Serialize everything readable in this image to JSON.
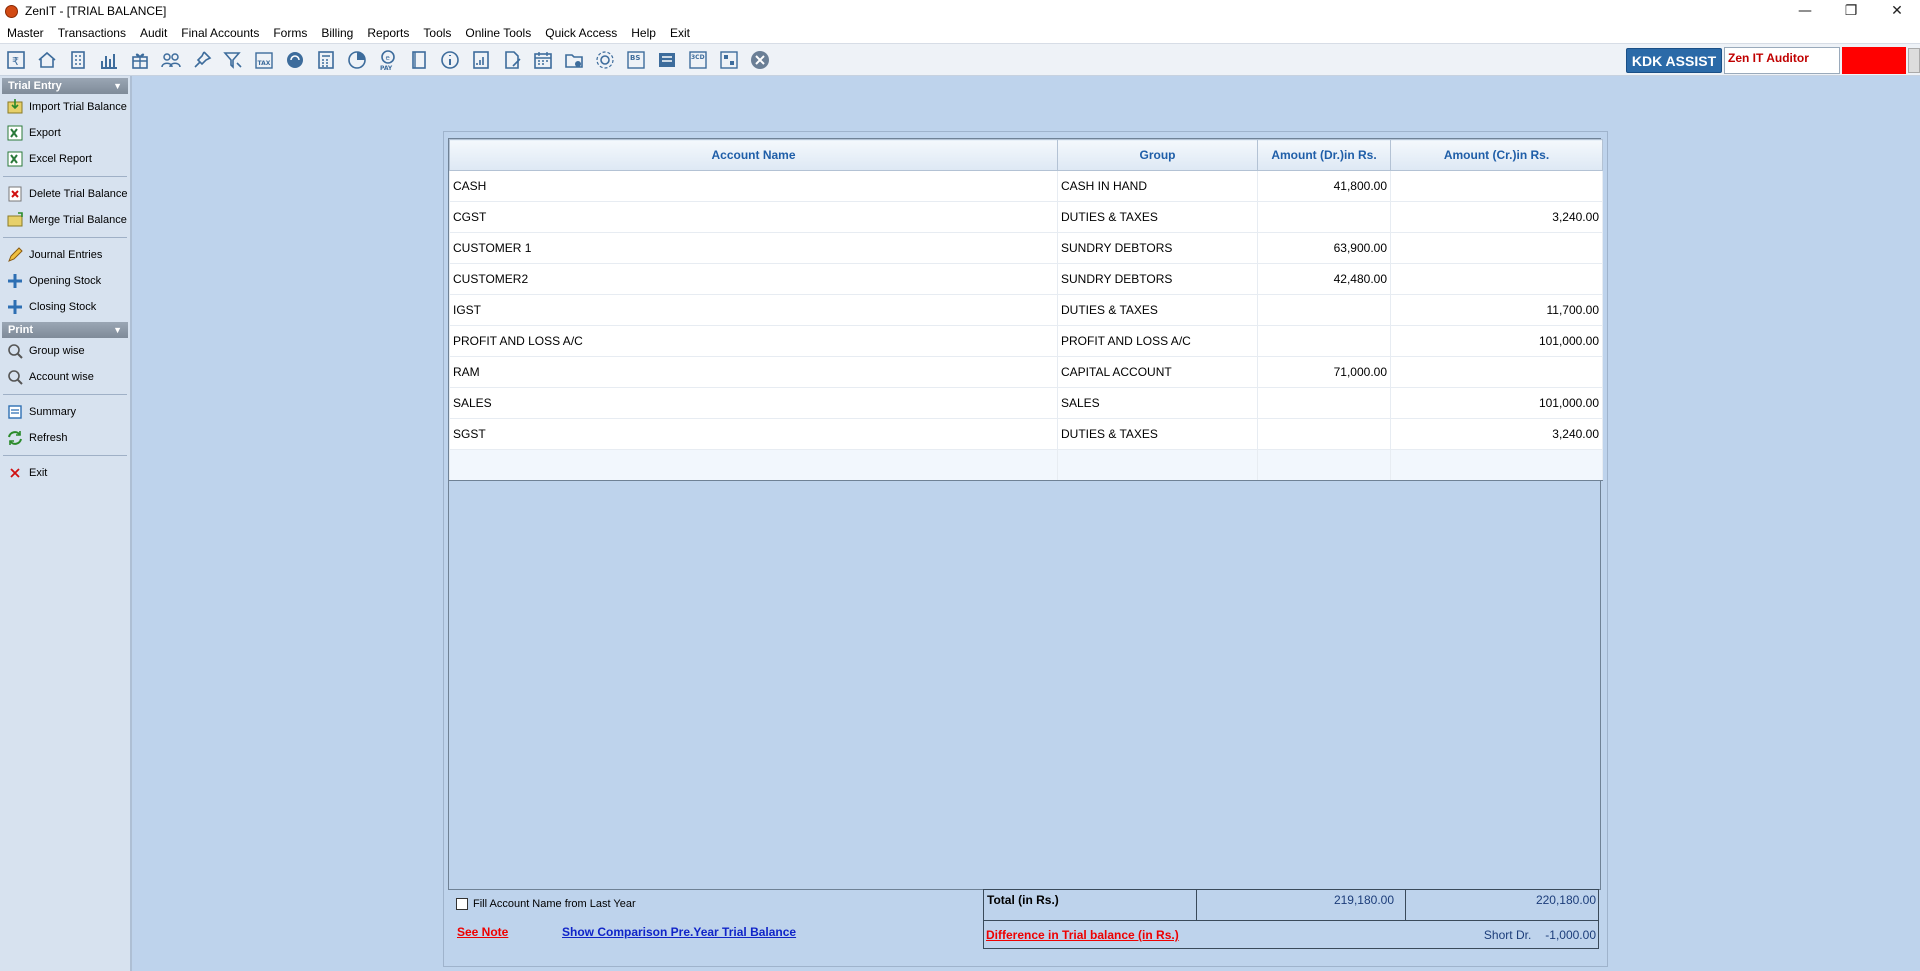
{
  "window": {
    "title": "ZenIT - [TRIAL BALANCE]"
  },
  "menu": [
    "Master",
    "Transactions",
    "Audit",
    "Final Accounts",
    "Forms",
    "Billing",
    "Reports",
    "Tools",
    "Online Tools",
    "Quick Access",
    "Help",
    "Exit"
  ],
  "toolbar": {
    "icons": [
      "rupee-doc-icon",
      "home-icon",
      "building-icon",
      "bar-chart-icon",
      "gift-icon",
      "users-icon",
      "pin-icon",
      "filter-icon",
      "tax-icon",
      "refresh-circle-icon",
      "calculator-icon",
      "pie-chart-icon",
      "pay-icon",
      "book-icon",
      "info-icon",
      "report-icon",
      "doc-edit-icon",
      "calendar-icon",
      "folder-add-icon",
      "gear-icon",
      "bs-icon",
      "db-icon",
      "3cd-icon",
      "qr-icon",
      "close-circle-icon"
    ],
    "kdk_label": "KDK ASSIST",
    "auditor_label": "Zen IT Auditor"
  },
  "sidebar": {
    "trial_entry_header": "Trial Entry",
    "print_header": "Print",
    "items1": [
      "Import Trial Balance",
      "Export",
      "Excel Report"
    ],
    "items2": [
      "Delete Trial Balance",
      "Merge Trial Balance"
    ],
    "items3": [
      "Journal Entries",
      "Opening Stock",
      "Closing Stock"
    ],
    "items4": [
      "Group wise",
      "Account wise"
    ],
    "items5": [
      "Summary",
      "Refresh"
    ],
    "exit": "Exit"
  },
  "grid": {
    "headers": [
      "Account Name",
      "Group",
      "Amount (Dr.)in Rs.",
      "Amount (Cr.)in Rs."
    ],
    "rows": [
      [
        "CASH",
        "CASH IN HAND",
        "41,800.00",
        ""
      ],
      [
        "CGST",
        "DUTIES & TAXES",
        "",
        "3,240.00"
      ],
      [
        "CUSTOMER 1",
        "SUNDRY DEBTORS",
        "63,900.00",
        ""
      ],
      [
        "CUSTOMER2",
        "SUNDRY DEBTORS",
        "42,480.00",
        ""
      ],
      [
        "IGST",
        "DUTIES & TAXES",
        "",
        "11,700.00"
      ],
      [
        "PROFIT AND LOSS A/C",
        "PROFIT AND LOSS A/C",
        "",
        "101,000.00"
      ],
      [
        "RAM",
        "CAPITAL ACCOUNT",
        "71,000.00",
        ""
      ],
      [
        "SALES",
        "SALES",
        "",
        "101,000.00"
      ],
      [
        "SGST",
        "DUTIES & TAXES",
        "",
        "3,240.00"
      ]
    ]
  },
  "footer": {
    "fill_label": "Fill Account Name from Last Year",
    "see_note": "See Note",
    "show_comparison": "Show Comparison Pre.Year Trial Balance",
    "total_label": "Total (in Rs.)",
    "total_dr": "219,180.00",
    "total_cr": "220,180.00",
    "diff_label": "Difference in Trial balance (in Rs.)",
    "diff_type": "Short Dr.",
    "diff_value": "-1,000.00"
  }
}
